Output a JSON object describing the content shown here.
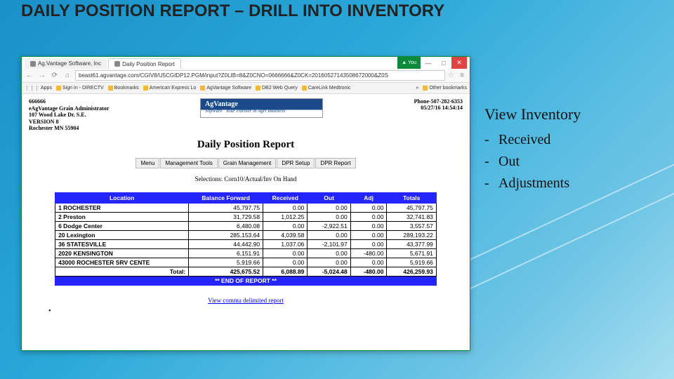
{
  "slide": {
    "title": "DAILY POSITION REPORT – DRILL INTO INVENTORY"
  },
  "side": {
    "heading": "View Inventory",
    "items": [
      "Received",
      "Out",
      "Adjustments"
    ]
  },
  "browser": {
    "tabs": [
      {
        "label": "Ag.Vantage Software, Inc"
      },
      {
        "label": "Daily Position Report"
      }
    ],
    "you_label": "You",
    "url": "beast61.agvantage.com/CGIV8/U5CGIDP12.PGM/input?Z0LIB=8&Z0CNO=0666666&Z0CK=20160527143508672000&Z0S",
    "bookmarks": [
      "Apps",
      "Sign In - DIRECTV",
      "Bookmarks",
      "American Express Lo",
      "AgVantage Software",
      "DB2 Web Query",
      "CareLink Medtronic"
    ],
    "other_bookmarks": "Other bookmarks"
  },
  "page": {
    "company": {
      "id": "666666",
      "name": "eAgVantage Grain Administrator",
      "addr1": "107 Wood Lake Dr. S.E.",
      "ver": "VERSION 8",
      "city": "Rochester MN 55904",
      "phone": "Phone-507-282-6353",
      "timestamp": "05/27/16 14:54:14",
      "logo_top": "AgVantage",
      "logo_sub": "Software",
      "logo_tag": "Your Partner in Agri Business"
    },
    "report_title": "Daily Position Report",
    "menu": [
      "Menu",
      "Management Tools",
      "Grain Management",
      "DPR Setup",
      "DPR Report"
    ],
    "selections": "Selections: Corn10/Actual/Inv On Hand",
    "columns": [
      "Location",
      "Balance Forward",
      "Received",
      "Out",
      "Adj",
      "Totals"
    ],
    "rows": [
      {
        "loc": "1 ROCHESTER",
        "bf": "45,797.75",
        "rec": "0.00",
        "out": "0.00",
        "adj": "0.00",
        "tot": "45,797.75"
      },
      {
        "loc": "2 Preston",
        "bf": "31,729.58",
        "rec": "1,012.25",
        "out": "0.00",
        "adj": "0.00",
        "tot": "32,741.83"
      },
      {
        "loc": "6 Dodge Center",
        "bf": "6,480.08",
        "rec": "0.00",
        "out": "-2,922.51",
        "adj": "0.00",
        "tot": "3,557.57"
      },
      {
        "loc": "20 Lexington",
        "bf": "285,153.64",
        "rec": "4,039.58",
        "out": "0.00",
        "adj": "0.00",
        "tot": "289,193.22"
      },
      {
        "loc": "36 STATESVILLE",
        "bf": "44,442.90",
        "rec": "1,037.06",
        "out": "-2,101.97",
        "adj": "0.00",
        "tot": "43,377.99"
      },
      {
        "loc": "2020 KENSINGTON",
        "bf": "6,151.91",
        "rec": "0.00",
        "out": "0.00",
        "adj": "-480.00",
        "tot": "5,671.91"
      },
      {
        "loc": "43000 ROCHESTER SRV CENTE",
        "bf": "5,919.66",
        "rec": "0.00",
        "out": "0.00",
        "adj": "0.00",
        "tot": "5,919.66"
      }
    ],
    "total": {
      "label": "Total:",
      "bf": "425,675.52",
      "rec": "6,088.89",
      "out": "-5,024.48",
      "adj": "-480.00",
      "tot": "426,259.93"
    },
    "end": "** END OF REPORT **",
    "csv_link": "View comma delimited report"
  },
  "chart_data": {
    "type": "table",
    "title": "Daily Position Report",
    "columns": [
      "Location",
      "Balance Forward",
      "Received",
      "Out",
      "Adj",
      "Totals"
    ],
    "rows": [
      [
        "1 ROCHESTER",
        45797.75,
        0.0,
        0.0,
        0.0,
        45797.75
      ],
      [
        "2 Preston",
        31729.58,
        1012.25,
        0.0,
        0.0,
        32741.83
      ],
      [
        "6 Dodge Center",
        6480.08,
        0.0,
        -2922.51,
        0.0,
        3557.57
      ],
      [
        "20 Lexington",
        285153.64,
        4039.58,
        0.0,
        0.0,
        289193.22
      ],
      [
        "36 STATESVILLE",
        44442.9,
        1037.06,
        -2101.97,
        0.0,
        43377.99
      ],
      [
        "2020 KENSINGTON",
        6151.91,
        0.0,
        0.0,
        -480.0,
        5671.91
      ],
      [
        "43000 ROCHESTER SRV CENTE",
        5919.66,
        0.0,
        0.0,
        0.0,
        5919.66
      ]
    ],
    "total": [
      "Total:",
      425675.52,
      6088.89,
      -5024.48,
      -480.0,
      426259.93
    ]
  }
}
